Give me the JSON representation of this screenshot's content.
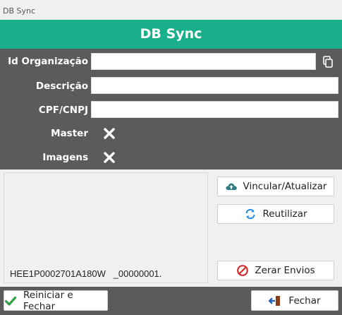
{
  "window": {
    "title": "DB Sync"
  },
  "header": {
    "title": "DB Sync"
  },
  "form": {
    "id_org_label": "Id Organização",
    "id_org_value": "",
    "descricao_label": "Descrição",
    "descricao_value": "",
    "cpf_cnpj_label": "CPF/CNPJ",
    "cpf_cnpj_value": "",
    "master_label": "Master",
    "master_icon": "x-icon",
    "imagens_label": "Imagens",
    "imagens_icon": "x-icon",
    "copy_icon": "copy-icon"
  },
  "info": {
    "text": "HEE1P0002701A180W   _00000001."
  },
  "buttons": {
    "vincular_label": "Vincular/Atualizar",
    "vincular_icon": "cloud-upload-icon",
    "reutilizar_label": "Reutilizar",
    "reutilizar_icon": "refresh-icon",
    "zerar_label": "Zerar Envios",
    "zerar_icon": "ban-icon",
    "reiniciar_label": "Reiniciar e Fechar",
    "reiniciar_icon": "check-icon",
    "fechar_label": "Fechar",
    "fechar_icon": "exit-door-icon"
  },
  "colors": {
    "accent": "#1aaf8b",
    "panel": "#5b5b5b",
    "cloud": "#2e7d80",
    "refresh": "#1e88e5",
    "ban": "#d32f2f",
    "check": "#2ea043",
    "door": "#8b3a1a"
  }
}
